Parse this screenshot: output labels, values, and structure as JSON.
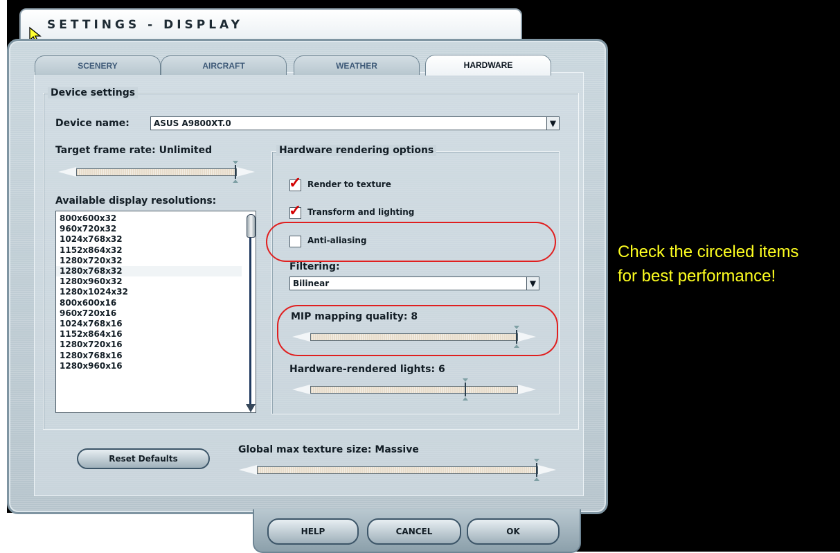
{
  "window": {
    "title": "SETTINGS - DISPLAY"
  },
  "tabs": [
    {
      "label": "SCENERY",
      "active": false
    },
    {
      "label": "AIRCRAFT",
      "active": false
    },
    {
      "label": "WEATHER",
      "active": false
    },
    {
      "label": "HARDWARE",
      "active": true
    }
  ],
  "device_settings": {
    "group_title": "Device settings",
    "device_name_label": "Device name:",
    "device_name_value": "ASUS A9800XT.0",
    "target_frame_rate_label": "Target frame rate: Unlimited",
    "target_frame_rate_level": 1.0,
    "resolutions_label": "Available display resolutions:",
    "resolutions": [
      "800x600x32",
      "960x720x32",
      "1024x768x32",
      "1152x864x32",
      "1280x720x32",
      "1280x768x32",
      "1280x960x32",
      "1280x1024x32",
      "800x600x16",
      "960x720x16",
      "1024x768x16",
      "1152x864x16",
      "1280x720x16",
      "1280x768x16",
      "1280x960x16"
    ],
    "selected_resolution": "1280x768x32"
  },
  "hardware_rendering": {
    "group_title": "Hardware rendering options",
    "render_to_texture_label": "Render to texture",
    "render_to_texture_checked": true,
    "transform_lighting_label": "Transform and lighting",
    "transform_lighting_checked": true,
    "anti_aliasing_label": "Anti-aliasing",
    "anti_aliasing_checked": false,
    "filtering_label": "Filtering:",
    "filtering_value": "Bilinear",
    "mip_label": "MIP mapping quality: 8",
    "mip_level": 1.0,
    "lights_label": "Hardware-rendered lights: 6",
    "lights_level": 0.75
  },
  "global_texture": {
    "label": "Global max texture size: Massive",
    "level": 1.0
  },
  "buttons": {
    "reset": "Reset Defaults",
    "help": "HELP",
    "cancel": "CANCEL",
    "ok": "OK"
  },
  "annotation": {
    "note": "Check the circeled items for best performance!",
    "color": "#ffff20"
  }
}
